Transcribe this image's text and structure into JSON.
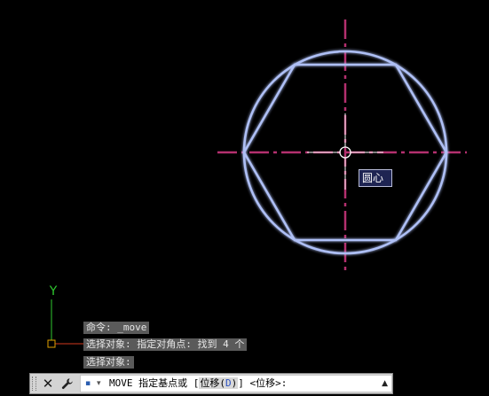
{
  "colors": {
    "background": "#000000",
    "geometry": "#aebff5",
    "geometry_glow": "#4a62d0",
    "centerline": "#b4306e",
    "ucs_y": "#2fc82f",
    "ucs_x": "#d23a1e",
    "ucs_origin": "#e0a000"
  },
  "drawing": {
    "shape_names": [
      "circle",
      "hexagon",
      "vertical-centerline",
      "horizontal-centerline"
    ]
  },
  "ucs": {
    "y_label": "Y"
  },
  "tooltip": {
    "text": "圆心"
  },
  "history": [
    "命令: _move",
    "选择对象: 指定对角点: 找到 4 个",
    "选择对象:"
  ],
  "command_line": {
    "close_icon": "✕",
    "settings_icon": "wrench-icon",
    "prompt_icon": "▪",
    "prompt_arrow": "▾",
    "prompt_prefix": "MOVE 指定基点或 [",
    "option_label": "位移(",
    "option_key": "D",
    "option_suffix": ")",
    "prompt_suffix": "] <位移>:",
    "history_toggle": "▲"
  }
}
